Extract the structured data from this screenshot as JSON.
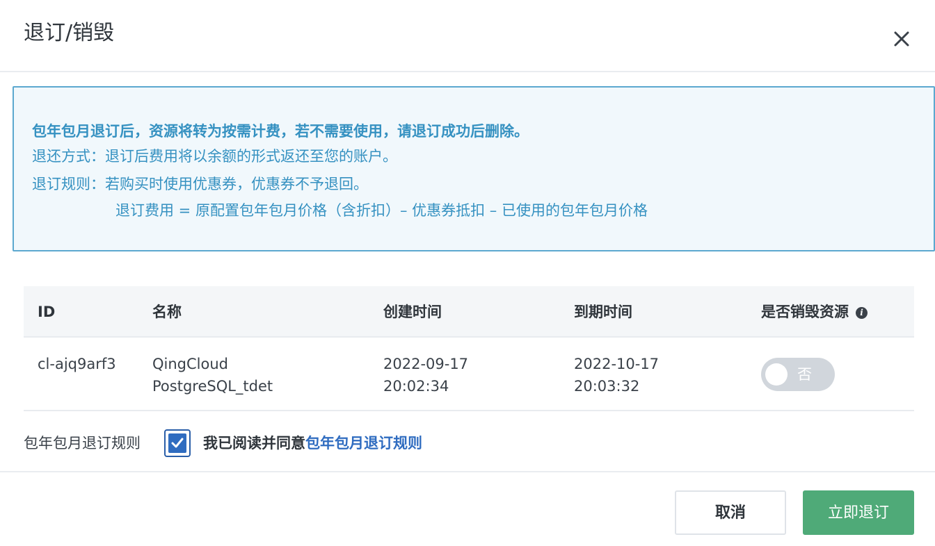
{
  "dialog": {
    "title": "退订/销毁"
  },
  "notice": {
    "line1": "包年包月退订后，资源将转为按需计费，若不需要使用，请退订成功后删除。",
    "line2": "退还方式：退订后费用将以余额的形式返还至您的账户。",
    "line3": "退订规则：若购买时使用优惠券，优惠券不予退回。",
    "line4": "退订费用 = 原配置包年包月价格（含折扣）– 优惠券抵扣 – 已使用的包年包月价格"
  },
  "table": {
    "headers": {
      "id": "ID",
      "name": "名称",
      "created": "创建时间",
      "expires": "到期时间",
      "destroy": "是否销毁资源"
    },
    "rows": [
      {
        "id": "cl-ajq9arf3",
        "name": "QingCloud PostgreSQL_tdet",
        "created": "2022-09-17 20:02:34",
        "expires": "2022-10-17 20:03:32",
        "destroy_label": "否"
      }
    ]
  },
  "agreement": {
    "label": "包年包月退订规则",
    "checked": true,
    "text": "我已阅读并同意",
    "link": "包年包月退订规则"
  },
  "footer": {
    "cancel_label": "取消",
    "submit_label": "立即退订"
  },
  "colors": {
    "notice_text": "#3591c1",
    "notice_border": "#5ba8cf",
    "primary_button": "#4faa78",
    "link": "#2f6cc0"
  }
}
